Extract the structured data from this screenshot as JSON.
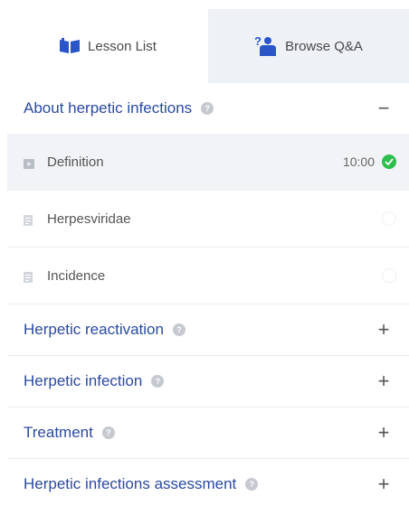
{
  "tabs": {
    "lesson_list": {
      "label": "Lesson List",
      "icon": "book-icon"
    },
    "browse_qa": {
      "label": "Browse Q&A",
      "icon": "question-person-icon"
    }
  },
  "sections": [
    {
      "title": "About herpetic infections",
      "expanded": true,
      "toggle": "−",
      "lessons": [
        {
          "title": "Definition",
          "duration": "10:00",
          "status": "completed",
          "icon": "video-icon"
        },
        {
          "title": "Herpesviridae",
          "duration": "",
          "status": "incomplete",
          "icon": "document-icon"
        },
        {
          "title": "Incidence",
          "duration": "",
          "status": "incomplete",
          "icon": "document-icon"
        }
      ]
    },
    {
      "title": "Herpetic reactivation",
      "expanded": false,
      "toggle": "+"
    },
    {
      "title": "Herpetic infection",
      "expanded": false,
      "toggle": "+"
    },
    {
      "title": "Treatment",
      "expanded": false,
      "toggle": "+"
    },
    {
      "title": "Herpetic infections assessment",
      "expanded": false,
      "toggle": "+"
    }
  ],
  "colors": {
    "section_title": "#2b4aa0",
    "tab_icon": "#2a55c9",
    "inactive_tab_bg": "#eef1f5",
    "selected_row_bg": "#f1f3f6",
    "completed": "#2dbe4e"
  }
}
